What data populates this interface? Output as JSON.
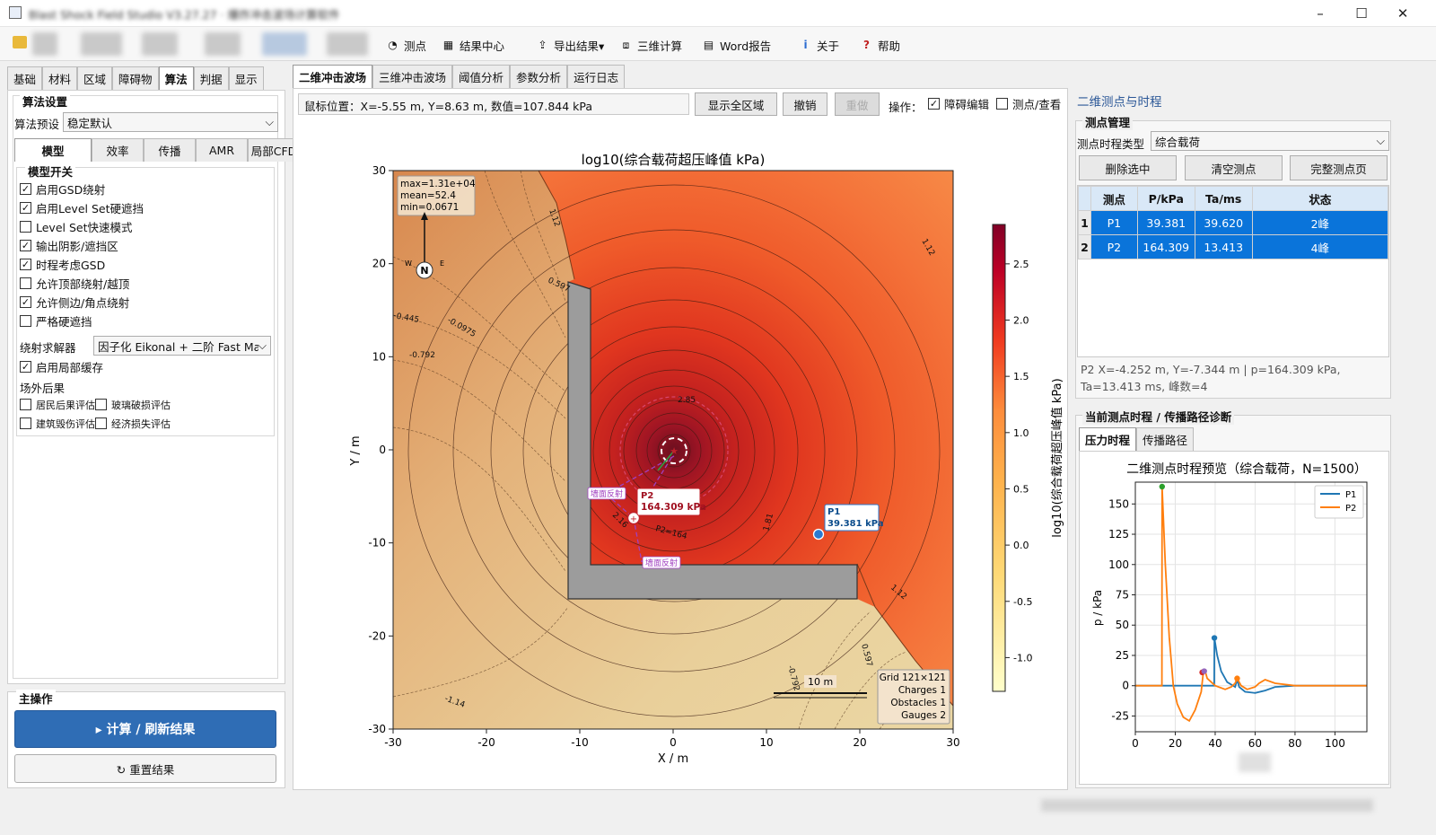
{
  "window": {
    "title": "Blast Shock Field Studio V3.27.27 · 爆炸冲击波场计算软件"
  },
  "toolbar": [
    {
      "label": "测点",
      "icon": "gauge-icon"
    },
    {
      "label": "结果中心",
      "icon": "results-center-icon"
    },
    {
      "label": "导出结果▾",
      "icon": "export-icon"
    },
    {
      "label": "三维计算",
      "icon": "3d-compute-icon"
    },
    {
      "label": "Word报告",
      "icon": "word-report-icon"
    },
    {
      "label": "关于",
      "icon": "info-icon"
    },
    {
      "label": "帮助",
      "icon": "help-icon"
    }
  ],
  "left": {
    "tabs": [
      "基础",
      "材料",
      "区域",
      "障碍物",
      "算法",
      "判据",
      "显示"
    ],
    "active_tab": "算法",
    "algo_group": "算法设置",
    "preset_label": "算法预设",
    "preset_value": "稳定默认",
    "subtabs": [
      "模型",
      "效率",
      "传播",
      "AMR",
      "局部CFD"
    ],
    "switch_group": "模型开关",
    "checks": [
      {
        "label": "启用GSD绕射",
        "checked": true
      },
      {
        "label": "启用Level Set硬遮挡",
        "checked": true
      },
      {
        "label": "Level Set快速模式",
        "checked": false
      },
      {
        "label": "输出阴影/遮挡区",
        "checked": true
      },
      {
        "label": "时程考虑GSD",
        "checked": true
      },
      {
        "label": "允许顶部绕射/越顶",
        "checked": false
      },
      {
        "label": "允许侧边/角点绕射",
        "checked": true
      },
      {
        "label": "严格硬遮挡",
        "checked": false
      }
    ],
    "solver_label": "绕射求解器",
    "solver_value": "因子化 Eikonal + 二阶 Fast Ma",
    "cache": {
      "label": "启用局部缓存",
      "checked": true
    },
    "offsite_label": "场外后果",
    "offsite_checks": [
      {
        "label": "居民后果评估",
        "checked": false
      },
      {
        "label": "玻璃破损评估",
        "checked": false
      },
      {
        "label": "建筑毁伤评估",
        "checked": false
      },
      {
        "label": "经济损失评估",
        "checked": false
      }
    ],
    "main_ops": "主操作",
    "compute_btn": "▸  计算 / 刷新结果",
    "reset_btn": "↻  重置结果"
  },
  "center": {
    "tabs": [
      "二维冲击波场",
      "三维冲击波场",
      "阈值分析",
      "参数分析",
      "运行日志"
    ],
    "active_tab": "二维冲击波场",
    "mouse_pos": "鼠标位置：X=-5.55 m, Y=8.63 m, 数值=107.844 kPa",
    "show_all_btn": "显示全区域",
    "undo_btn": "撤销",
    "redo_btn": "重做",
    "ops_label": "操作：",
    "obstacle_edit": {
      "label": "障碍编辑",
      "checked": true
    },
    "gauge_view": {
      "label": "测点/查看",
      "checked": false
    }
  },
  "map": {
    "title": "log10(综合载荷超压峰值 kPa)",
    "xlabel": "X / m",
    "ylabel": "Y / m",
    "xticks": [
      "-30",
      "-20",
      "-10",
      "0",
      "10",
      "20",
      "30"
    ],
    "yticks": [
      "30",
      "20",
      "10",
      "0",
      "-10",
      "-20",
      "-30"
    ],
    "cbar_label": "log10(综合载荷超压峰值 kPa)",
    "cbar_ticks": [
      "2.5",
      "2.0",
      "1.5",
      "1.0",
      "0.5",
      "0.0",
      "-0.5",
      "-1.0"
    ],
    "stats": [
      "max=1.31e+04",
      "mean=52.4",
      "min=0.0671"
    ],
    "grid_info": [
      "Grid 121×121",
      "Charges 1",
      "Obstacles 1",
      "Gauges 2"
    ],
    "scale_label": "10 m",
    "compass": {
      "N": "N",
      "W": "W",
      "E": "E"
    },
    "contours": [
      {
        "label": "1.12",
        "note": "upper left"
      },
      {
        "label": "1.12",
        "note": "upper right"
      },
      {
        "label": "0.597"
      },
      {
        "label": "-0.445"
      },
      {
        "label": "-0.0975"
      },
      {
        "label": "-0.792"
      },
      {
        "label": "2.85"
      },
      {
        "label": "1.81"
      },
      {
        "label": "1.12",
        "note": "lower right"
      },
      {
        "label": "0.597",
        "note": "lower right"
      },
      {
        "label": "-0.792",
        "note": "bottom"
      },
      {
        "label": "-1.14"
      },
      {
        "label": "2.16"
      },
      {
        "label": "P2=164"
      }
    ],
    "gauges": [
      {
        "name": "P1",
        "value": "39.381 kPa",
        "x": 15.5,
        "y": -9.0
      },
      {
        "name": "P2",
        "value": "164.309 kPa",
        "x": -4.25,
        "y": -7.34
      }
    ],
    "charge": {
      "x": 0,
      "y": 0
    },
    "reflection_labels": [
      "墙面反射",
      "墙面反射"
    ]
  },
  "right": {
    "section_title": "二维测点与时程",
    "mgmt_group": "测点管理",
    "type_label": "测点时程类型",
    "type_value": "综合载荷",
    "btn_delete": "删除选中",
    "btn_clear": "清空测点",
    "btn_full": "完整测点页",
    "table_headers": [
      "",
      "测点",
      "P/kPa",
      "Ta/ms",
      "状态"
    ],
    "rows": [
      [
        "1",
        "P1",
        "39.381",
        "39.620",
        "2峰"
      ],
      [
        "2",
        "P2",
        "164.309",
        "13.413",
        "4峰"
      ]
    ],
    "detail": "P2  X=-4.252 m, Y=-7.344 m  |  p=164.309 kPa,\nTa=13.413 ms, 峰数=4",
    "history_group": "当前测点时程 / 传播路径诊断",
    "history_tabs": [
      "压力时程",
      "传播路径"
    ],
    "history_active": "压力时程"
  },
  "chart_data": {
    "type": "line",
    "title": "二维测点时程预览（综合载荷，N=1500）",
    "xlabel": "",
    "ylabel": "p / kPa",
    "xlim": [
      0,
      116
    ],
    "ylim": [
      -38,
      168
    ],
    "xticks": [
      0,
      20,
      40,
      60,
      80,
      100
    ],
    "yticks": [
      -25,
      0,
      25,
      50,
      75,
      100,
      125,
      150
    ],
    "legend": "top-right",
    "grid": true,
    "series": [
      {
        "name": "P1",
        "color": "#1f77b4",
        "x": [
          0,
          39.5,
          39.6,
          41,
          43,
          46,
          50,
          51,
          52,
          55,
          60,
          65,
          70,
          80,
          116
        ],
        "y": [
          0,
          0,
          39.4,
          25,
          12,
          3,
          -1,
          5,
          -1,
          -5,
          -6,
          -4,
          -1,
          0,
          0
        ]
      },
      {
        "name": "P2",
        "color": "#ff7f0e",
        "x": [
          0,
          13.3,
          13.4,
          15,
          17,
          19,
          21,
          24,
          27,
          30,
          33,
          34,
          35,
          36,
          40,
          45,
          48,
          50,
          51,
          53,
          56,
          60,
          62,
          65,
          70,
          80,
          116
        ],
        "y": [
          0,
          0,
          164.3,
          100,
          40,
          0,
          -15,
          -26,
          -29,
          -20,
          -5,
          10,
          12,
          6,
          0,
          -3,
          -1,
          2,
          6,
          0,
          -3,
          -1,
          2,
          5,
          2,
          0,
          0
        ]
      }
    ],
    "markers": [
      {
        "series": "P2",
        "x": 13.4,
        "y": 164.3,
        "color": "#2ca02c"
      },
      {
        "series": "P1",
        "x": 39.6,
        "y": 39.4,
        "color": "#1f77b4"
      },
      {
        "series": "P2",
        "x": 33.5,
        "y": 11,
        "color": "#d62728"
      },
      {
        "series": "P2",
        "x": 34.5,
        "y": 12,
        "color": "#9467bd"
      },
      {
        "series": "P2",
        "x": 51,
        "y": 6,
        "color": "#ff7f0e"
      }
    ]
  }
}
